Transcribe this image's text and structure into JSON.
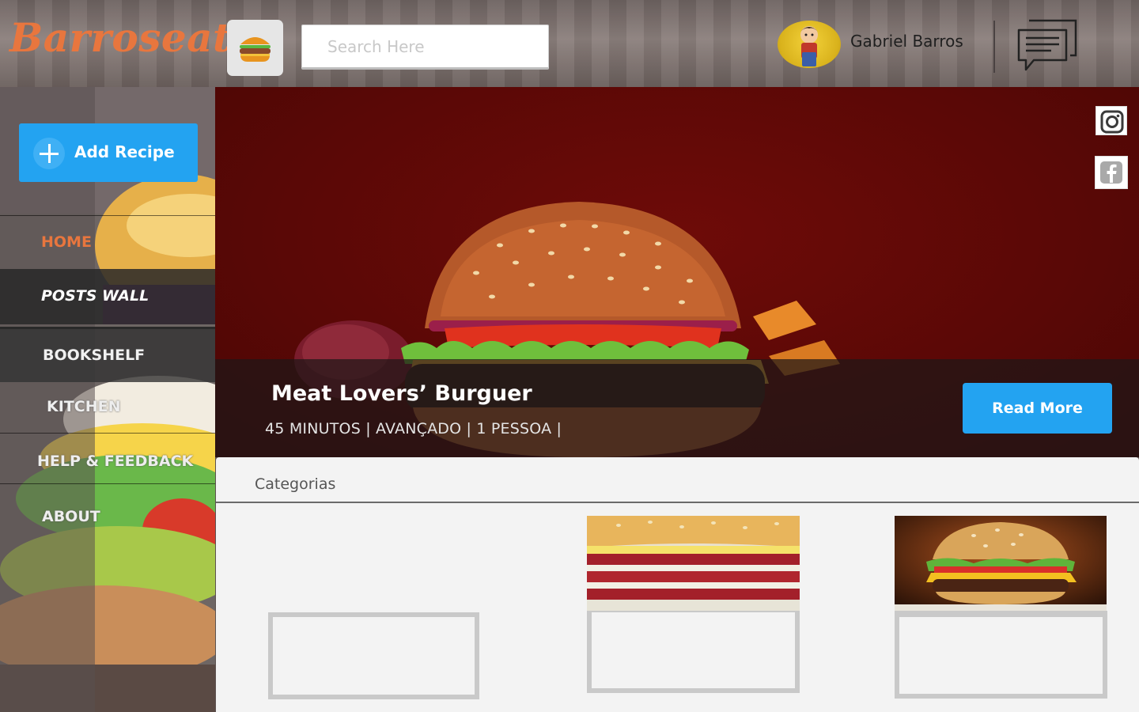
{
  "app": {
    "logo_text": "Barroseat",
    "brand_color": "#e8763e",
    "accent_color": "#23a3f1"
  },
  "header": {
    "search_placeholder": "Search Here",
    "search_value": "",
    "user_name": "Gabriel Barros",
    "icons": [
      "burger-icon",
      "chat-icon"
    ]
  },
  "sidebar": {
    "add_recipe_label": "Add Recipe",
    "items": [
      {
        "label": "HOME",
        "active": true
      },
      {
        "label": "POSTS WALL"
      },
      {
        "label": "BOOKSHELF"
      },
      {
        "label": "KITCHEN"
      },
      {
        "label": "HELP & FEEDBACK"
      },
      {
        "label": "ABOUT"
      }
    ]
  },
  "hero": {
    "title": "Meat Lovers’ Burguer",
    "meta": "45 MINUTOS | AVANÇADO | 1 PESSOA |",
    "read_more_label": "Read More",
    "social_icons": [
      "instagram-icon",
      "facebook-icon"
    ]
  },
  "categories": {
    "title": "Categorias"
  }
}
